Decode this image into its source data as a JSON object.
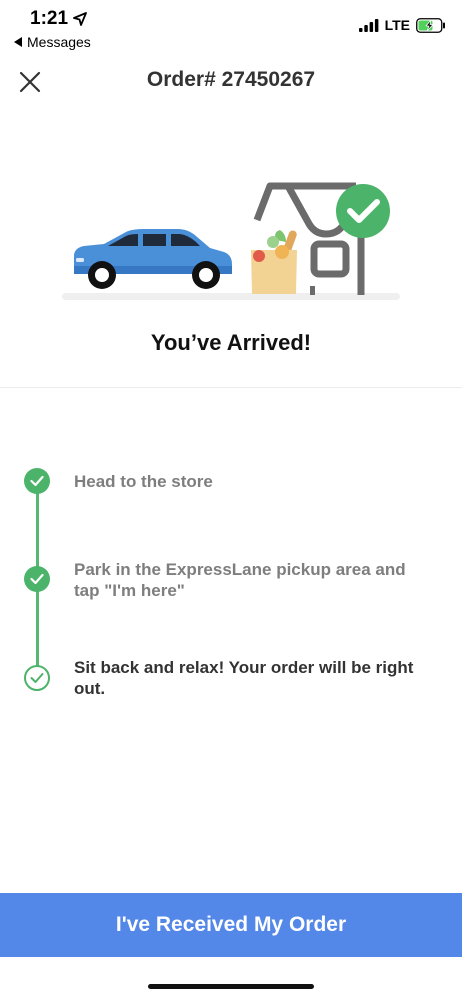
{
  "status_bar": {
    "time": "1:21",
    "back_label": "Messages",
    "network": "LTE"
  },
  "header": {
    "order_title": "Order# 27450267"
  },
  "arrival": {
    "headline": "You’ve Arrived!"
  },
  "steps": [
    {
      "label": "Head to the store",
      "state": "done"
    },
    {
      "label": "Park in the ExpressLane pickup area and tap \"I'm here\"",
      "state": "done"
    },
    {
      "label": "Sit back and relax! Your order will be right out.",
      "state": "current"
    }
  ],
  "footer": {
    "button_label": "I've Received My Order"
  },
  "colors": {
    "accent_blue": "#5387e8",
    "success_green": "#4cb46a",
    "car_blue": "#4a90d9",
    "store_gray": "#6b6b6b"
  },
  "icons": {
    "close": "close-icon",
    "location": "location-arrow-icon",
    "back": "back-triangle-icon",
    "signal": "signal-icon",
    "battery": "battery-charging-icon",
    "check": "check-icon"
  }
}
